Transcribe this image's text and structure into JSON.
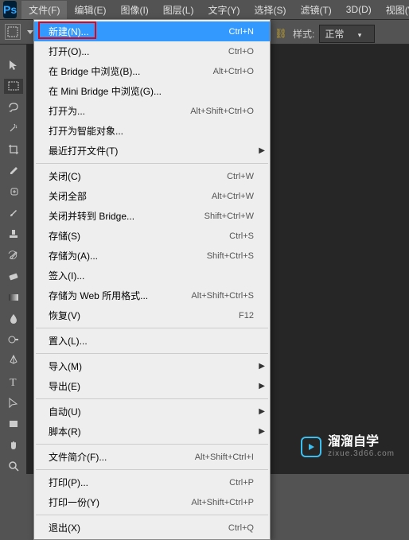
{
  "menubar": {
    "items": [
      "文件(F)",
      "编辑(E)",
      "图像(I)",
      "图层(L)",
      "文字(Y)",
      "选择(S)",
      "滤镜(T)",
      "3D(D)",
      "视图(V"
    ]
  },
  "dropdown": {
    "groups": [
      [
        {
          "label": "新建(N)...",
          "shortcut": "Ctrl+N",
          "highlighted": true
        },
        {
          "label": "打开(O)...",
          "shortcut": "Ctrl+O"
        },
        {
          "label": "在 Bridge 中浏览(B)...",
          "shortcut": "Alt+Ctrl+O"
        },
        {
          "label": "在 Mini Bridge 中浏览(G)..."
        },
        {
          "label": "打开为...",
          "shortcut": "Alt+Shift+Ctrl+O"
        },
        {
          "label": "打开为智能对象..."
        },
        {
          "label": "最近打开文件(T)",
          "submenu": true
        }
      ],
      [
        {
          "label": "关闭(C)",
          "shortcut": "Ctrl+W"
        },
        {
          "label": "关闭全部",
          "shortcut": "Alt+Ctrl+W"
        },
        {
          "label": "关闭并转到 Bridge...",
          "shortcut": "Shift+Ctrl+W"
        },
        {
          "label": "存储(S)",
          "shortcut": "Ctrl+S"
        },
        {
          "label": "存储为(A)...",
          "shortcut": "Shift+Ctrl+S"
        },
        {
          "label": "签入(I)..."
        },
        {
          "label": "存储为 Web 所用格式...",
          "shortcut": "Alt+Shift+Ctrl+S"
        },
        {
          "label": "恢复(V)",
          "shortcut": "F12"
        }
      ],
      [
        {
          "label": "置入(L)..."
        }
      ],
      [
        {
          "label": "导入(M)",
          "submenu": true
        },
        {
          "label": "导出(E)",
          "submenu": true
        }
      ],
      [
        {
          "label": "自动(U)",
          "submenu": true
        },
        {
          "label": "脚本(R)",
          "submenu": true
        }
      ],
      [
        {
          "label": "文件简介(F)...",
          "shortcut": "Alt+Shift+Ctrl+I"
        }
      ],
      [
        {
          "label": "打印(P)...",
          "shortcut": "Ctrl+P"
        },
        {
          "label": "打印一份(Y)",
          "shortcut": "Alt+Shift+Ctrl+P"
        }
      ],
      [
        {
          "label": "退出(X)",
          "shortcut": "Ctrl+Q"
        }
      ]
    ]
  },
  "toolbar": {
    "style_label": "样式:",
    "style_value": "正常"
  },
  "tools": [
    "move",
    "marquee",
    "lasso",
    "wand",
    "crop",
    "eyedropper",
    "healing",
    "brush",
    "stamp",
    "history",
    "eraser",
    "gradient",
    "blur",
    "dodge",
    "pen",
    "type",
    "path",
    "rectangle",
    "hand",
    "zoom"
  ],
  "watermark": {
    "main": "溜溜自学",
    "sub": "zixue.3d66.com"
  }
}
